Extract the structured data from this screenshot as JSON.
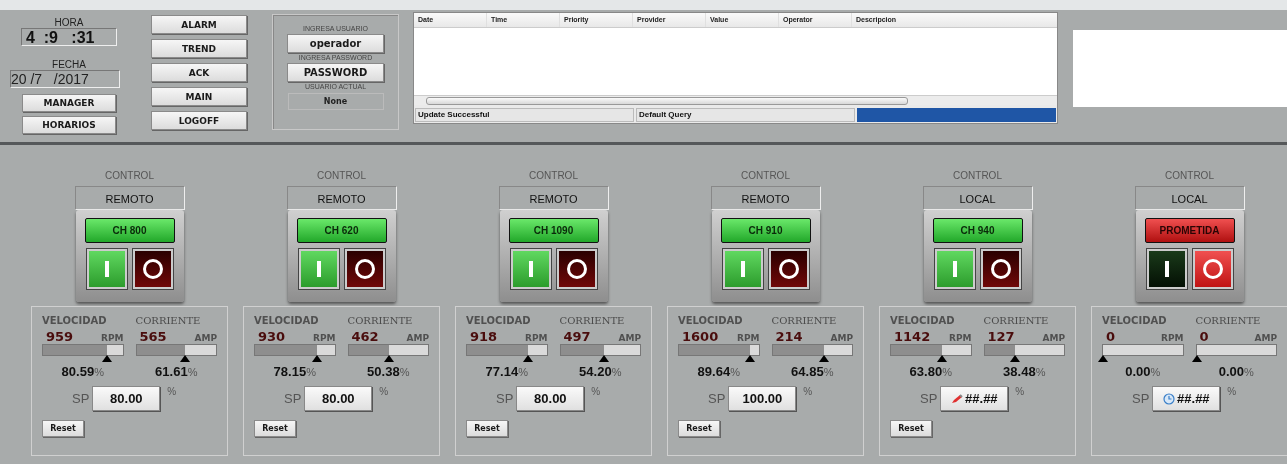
{
  "clock": {
    "time_label": "HORA",
    "time": "4  :9   :31",
    "date_label": "FECHA",
    "date": "20 /7   /2017",
    "buttons": [
      "MANAGER",
      "HORARIOS"
    ]
  },
  "nav_buttons": [
    "ALARM",
    "TREND",
    "ACK",
    "MAIN",
    "LOGOFF"
  ],
  "login": {
    "user_label": "INGRESA USUARIO",
    "user_button": "operador",
    "password_label": "INGRESA PASSWORD",
    "password_button": "PASSWORD",
    "current_label": "USUARIO ACTUAL",
    "current_user": "None"
  },
  "alarm_table": {
    "columns": [
      "Date",
      "Time",
      "Priority",
      "Provider",
      "Value",
      "Operator",
      "Descripcion"
    ],
    "status": "Update Successful",
    "query": "Default Query",
    "progress": {
      "level": 1
    }
  },
  "units": [
    {
      "control_label": "CONTROL",
      "mode": "REMOTO",
      "name": "CH 800",
      "running": true,
      "speed": {
        "label": "VELOCIDAD",
        "value": "959",
        "unit": "RPM",
        "percent": "80.59",
        "level": 0.8059
      },
      "current": {
        "label": "CORRIENTE",
        "value": "565",
        "unit": "AMP",
        "percent": "61.61",
        "level": 0.6161
      },
      "pct_sign": "%",
      "sp_label": "SP",
      "setpoint": {
        "kind": "plain",
        "value": "80.00"
      },
      "sp_unit": "%",
      "reset": "Reset"
    },
    {
      "control_label": "CONTROL",
      "mode": "REMOTO",
      "name": "CH 620",
      "running": true,
      "speed": {
        "label": "VELOCIDAD",
        "value": "930",
        "unit": "RPM",
        "percent": "78.15",
        "level": 0.7815
      },
      "current": {
        "label": "CORRIENTE",
        "value": "462",
        "unit": "AMP",
        "percent": "50.38",
        "level": 0.5038
      },
      "pct_sign": "%",
      "sp_label": "SP",
      "setpoint": {
        "kind": "plain",
        "value": "80.00"
      },
      "sp_unit": "%",
      "reset": "Reset"
    },
    {
      "control_label": "CONTROL",
      "mode": "REMOTO",
      "name": "CH 1090",
      "running": true,
      "speed": {
        "label": "VELOCIDAD",
        "value": "918",
        "unit": "RPM",
        "percent": "77.14",
        "level": 0.7714
      },
      "current": {
        "label": "CORRIENTE",
        "value": "497",
        "unit": "AMP",
        "percent": "54.20",
        "level": 0.542
      },
      "pct_sign": "%",
      "sp_label": "SP",
      "setpoint": {
        "kind": "plain",
        "value": "80.00"
      },
      "sp_unit": "%",
      "reset": "Reset"
    },
    {
      "control_label": "CONTROL",
      "mode": "REMOTO",
      "name": "CH 910",
      "running": true,
      "speed": {
        "label": "VELOCIDAD",
        "value": "1600",
        "unit": "RPM",
        "percent": "89.64",
        "level": 0.8964
      },
      "current": {
        "label": "CORRIENTE",
        "value": "214",
        "unit": "AMP",
        "percent": "64.85",
        "level": 0.6485
      },
      "pct_sign": "%",
      "sp_label": "SP",
      "setpoint": {
        "kind": "plain",
        "value": "100.00"
      },
      "sp_unit": "%",
      "reset": "Reset"
    },
    {
      "control_label": "CONTROL",
      "mode": "LOCAL",
      "name": "CH 940",
      "running": true,
      "speed": {
        "label": "VELOCIDAD",
        "value": "1142",
        "unit": "RPM",
        "percent": "63.80",
        "level": 0.638
      },
      "current": {
        "label": "CORRIENTE",
        "value": "127",
        "unit": "AMP",
        "percent": "38.48",
        "level": 0.3848
      },
      "pct_sign": "%",
      "sp_label": "SP",
      "setpoint": {
        "kind": "pencil",
        "value": "##.##"
      },
      "sp_unit": "%",
      "reset": "Reset"
    },
    {
      "control_label": "CONTROL",
      "mode": "LOCAL",
      "name": "PROMETIDA",
      "running": false,
      "speed": {
        "label": "VELOCIDAD",
        "value": "0",
        "unit": "RPM",
        "percent": "0.00",
        "level": 0
      },
      "current": {
        "label": "CORRIENTE",
        "value": "0",
        "unit": "AMP",
        "percent": "0.00",
        "level": 0
      },
      "pct_sign": "%",
      "sp_label": "SP",
      "setpoint": {
        "kind": "clock",
        "value": "##.##"
      },
      "sp_unit": "%"
    }
  ]
}
